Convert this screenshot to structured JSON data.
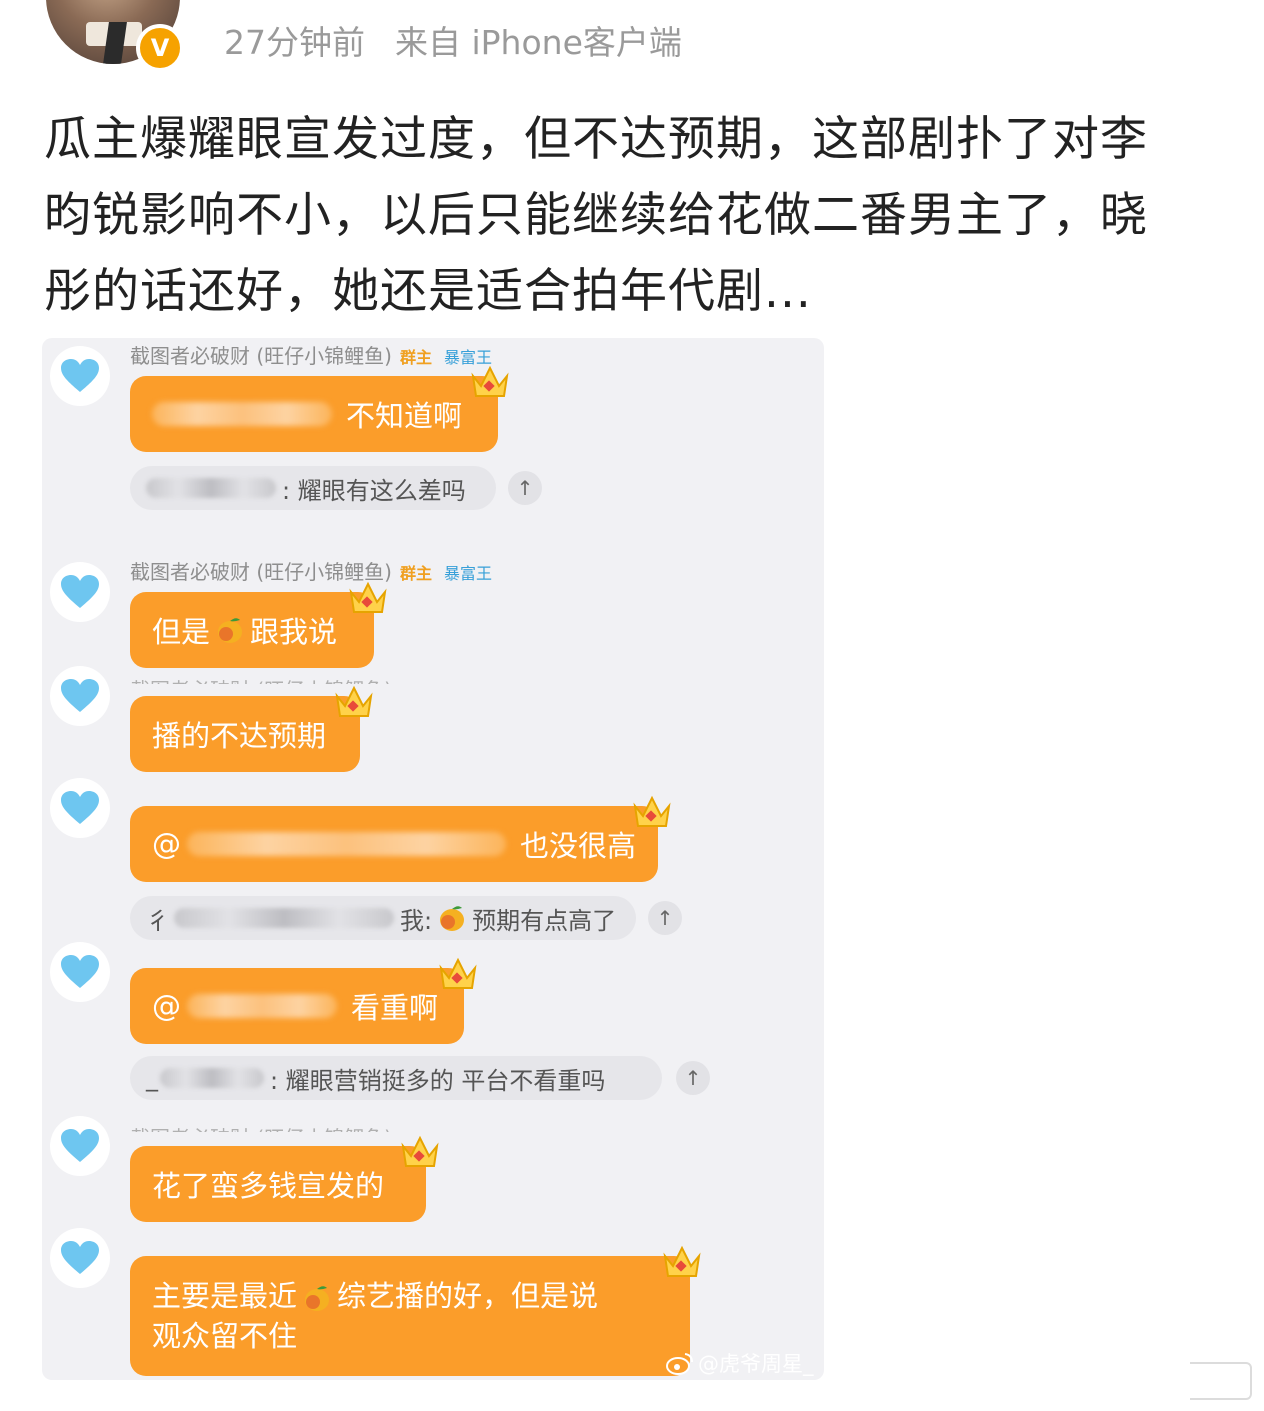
{
  "header": {
    "time": "27分钟前",
    "source": "来自 iPhone客户端",
    "verified_badge": "V"
  },
  "post": {
    "lines": [
      "瓜主爆耀眼宣发过度，但不达预期，这部剧扑了对李",
      "昀锐影响不小，以后只能继续给花做二番男主了，晓",
      "彤的话还好，她还是适合拍年代剧..."
    ]
  },
  "screenshot": {
    "sender_name": "截图者必破财 (旺仔小锦鲤鱼)",
    "tag_owner": "群主",
    "tag_rich": "暴富王",
    "messages": [
      {
        "text": "不知道啊",
        "quote": ": 耀眼有这么差吗"
      },
      {
        "text_before": "但是",
        "text_after": "跟我说"
      },
      {
        "text": "播的不达预期"
      },
      {
        "prefix": "@",
        "text": "也没很高",
        "quote_prefix": "彳",
        "quote_mid": "我:",
        "quote": "预期有点高了"
      },
      {
        "prefix": "@",
        "text": "看重啊",
        "quote_prefix": "_",
        "quote": ": 耀眼营销挺多的 平台不看重吗"
      },
      {
        "text": "花了蛮多钱宣发的"
      },
      {
        "text_before": "主要是最近",
        "text_after": "综艺播的好，但是说",
        "line2": "观众留不住"
      }
    ],
    "pin_glyph": "↑",
    "watermark": "@虎爷周星_"
  },
  "icons": {
    "heart": "heart-icon",
    "crown": "crown-icon",
    "mango": "mango-emoji-icon",
    "weibo": "weibo-logo-icon"
  },
  "colors": {
    "bubble": "#fb9d2a",
    "heart": "#6ec6f0",
    "badge": "#f6a200",
    "owner_tag": "#f0a020",
    "rich_tag": "#38a0d8"
  }
}
